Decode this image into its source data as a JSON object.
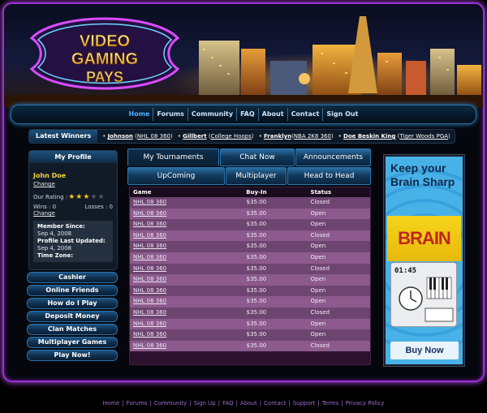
{
  "logo": {
    "text": "VIDEO GAMING PAYS"
  },
  "nav": {
    "items": [
      "Home",
      "Forums",
      "Community",
      "FAQ",
      "About",
      "Contact",
      "Sign Out"
    ]
  },
  "winners": {
    "title": "Latest Winners",
    "entries": [
      {
        "name": "Johnson",
        "game": "NHL 08 360"
      },
      {
        "name": "Gillbert",
        "game": "College Hoops"
      },
      {
        "name": "Franklyn",
        "game": "NBA 2K8 360"
      },
      {
        "name": "Doe Beskin King",
        "game": "Tiger Woods PGA"
      }
    ]
  },
  "profile": {
    "header": "My Profile",
    "name": "John Doe",
    "change_label": "Change",
    "rating_label": "Our Rating :",
    "rating_value": 3,
    "rating_max": 5,
    "wins_label": "Wins : 0",
    "losses_label": "Losses : 0",
    "change_label2": "Change",
    "member_since_label": "Member Since:",
    "member_since": "Sep 4, 2008",
    "updated_label": "Profile Last Updated:",
    "updated": "Sep 4, 2008",
    "timezone_label": "Time Zone:"
  },
  "sidebar_buttons": [
    "Cashier",
    "Online Friends",
    "How do I Play",
    "Deposit Money",
    "Clan Matches",
    "Multiplayer Games",
    "Play Now!"
  ],
  "tabs": {
    "my_tournaments": "My Tournaments",
    "chat_now": "Chat Now",
    "announcements": "Announcements",
    "upcoming": "UpComing",
    "multiplayer": "Multiplayer",
    "head_to_head": "Head to Head"
  },
  "table": {
    "headers": [
      "Game",
      "Buy-In",
      "Status"
    ],
    "rows": [
      [
        "NHL 08 360",
        "$35.00",
        "Closed"
      ],
      [
        "NHL 08 360",
        "$35.00",
        "Open"
      ],
      [
        "NHL 08 360",
        "$35.00",
        "Open"
      ],
      [
        "NHL 08 360",
        "$35.00",
        "Closed"
      ],
      [
        "NHL 08 360",
        "$35.00",
        "Open"
      ],
      [
        "NHL 08 360",
        "$35.00",
        "Open"
      ],
      [
        "NHL 08 360",
        "$35.00",
        "Closed"
      ],
      [
        "NHL 08 360",
        "$35.00",
        "Open"
      ],
      [
        "NHL 08 360",
        "$35.00",
        "Open"
      ],
      [
        "NHL 08 360",
        "$35.00",
        "Open"
      ],
      [
        "NHL 08 360",
        "$35.00",
        "Closed"
      ],
      [
        "NHL 08 360",
        "$35.00",
        "Open"
      ],
      [
        "NHL 08 360",
        "$35.00",
        "Open"
      ],
      [
        "NHL 08 360",
        "$35.00",
        "Closed"
      ]
    ]
  },
  "ad": {
    "title": "Keep your Brain Sharp",
    "brand": "BRAIN AGE",
    "time": "01:45",
    "cta": "Buy Now"
  },
  "footer": {
    "links": [
      "Home",
      "Forums",
      "Community",
      "Sign Up",
      "FAQ",
      "About",
      "Contact",
      "Support",
      "Terms",
      "Privacy Policy"
    ]
  },
  "colors": {
    "frame_glow": "#c34dff",
    "nav_active": "#4fb0ff",
    "profile_name": "#f5d23b",
    "star": "#f5c518",
    "footer_link": "#9d6fd4"
  }
}
